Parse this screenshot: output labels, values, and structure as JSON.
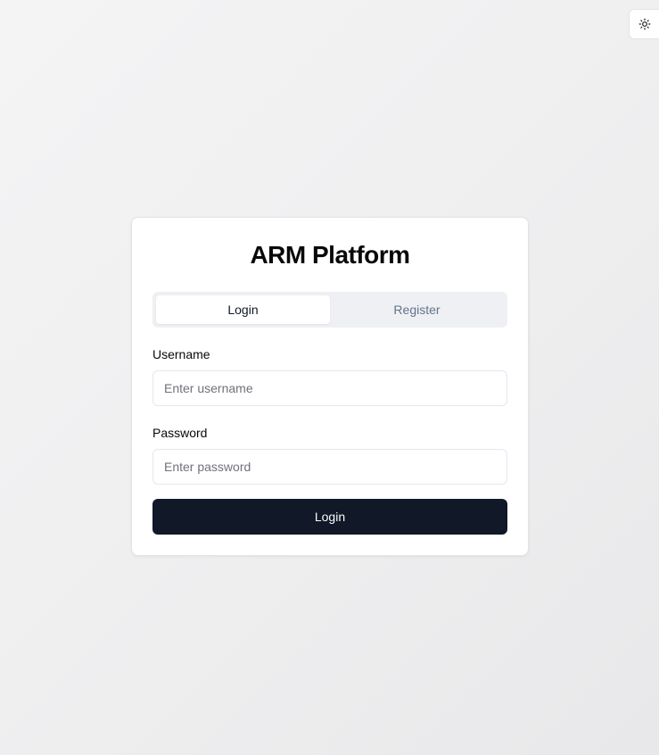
{
  "theme_toggle": {
    "icon": "sun-icon"
  },
  "card": {
    "title": "ARM Platform",
    "tabs": [
      {
        "label": "Login",
        "active": true
      },
      {
        "label": "Register",
        "active": false
      }
    ],
    "form": {
      "username_label": "Username",
      "username_value": "",
      "username_placeholder": "Enter username",
      "password_label": "Password",
      "password_value": "",
      "password_placeholder": "Enter password",
      "submit_label": "Login"
    }
  },
  "colors": {
    "primary_button": "#111827",
    "tab_background": "#eef0f4"
  }
}
